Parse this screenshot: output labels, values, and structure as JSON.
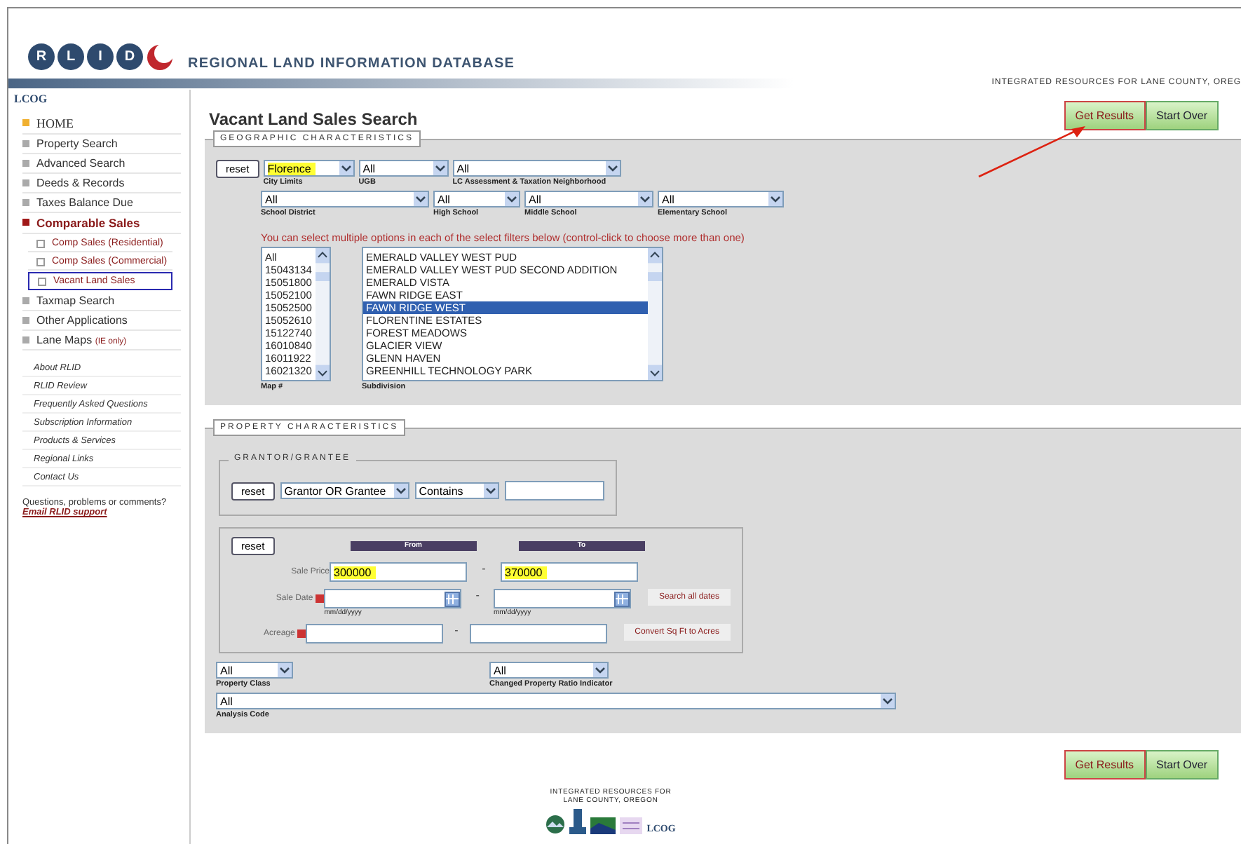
{
  "header": {
    "logo_letters": [
      "R",
      "L",
      "I",
      "D"
    ],
    "title": "REGIONAL LAND INFORMATION DATABASE",
    "tagline": "INTEGRATED RESOURCES FOR LANE COUNTY, OREG"
  },
  "sidebar": {
    "org": "LCOG",
    "items": [
      {
        "label": "HOME",
        "kind": "home",
        "selected": false
      },
      {
        "label": "Property Search",
        "kind": "main",
        "selected": false
      },
      {
        "label": "Advanced Search",
        "kind": "main",
        "selected": false
      },
      {
        "label": "Deeds & Records",
        "kind": "main",
        "selected": false
      },
      {
        "label": "Taxes Balance Due",
        "kind": "main",
        "selected": false
      },
      {
        "label": "Comparable Sales",
        "kind": "main",
        "selected": true
      },
      {
        "label": "Comp Sales (Residential)",
        "kind": "sub",
        "selected": false
      },
      {
        "label": "Comp Sales (Commercial)",
        "kind": "sub",
        "selected": false
      },
      {
        "label": "Vacant Land Sales",
        "kind": "sub",
        "selected": true
      },
      {
        "label": "Taxmap Search",
        "kind": "main",
        "selected": false
      },
      {
        "label": "Other Applications",
        "kind": "main",
        "selected": false
      },
      {
        "label": "Lane Maps",
        "note": "(IE only)",
        "kind": "main",
        "selected": false
      }
    ],
    "links": [
      "About RLID",
      "RLID Review",
      "Frequently Asked Questions",
      "Subscription Information",
      "Products & Services",
      "Regional Links",
      "Contact Us"
    ],
    "help_text": "Questions, problems or comments?",
    "help_link": "Email RLID support"
  },
  "page_title": "Vacant Land Sales Search",
  "top_buttons": [
    {
      "label": "Get Results",
      "kind": "primary"
    },
    {
      "label": "Start Over",
      "kind": "secondary"
    }
  ],
  "geographic": {
    "legend": "GEOGRAPHIC CHARACTERISTICS",
    "reset": "reset",
    "row_1": [
      {
        "value": "Florence",
        "label": "City Limits",
        "highlighted": true
      },
      {
        "value": "All",
        "label": "UGB",
        "highlighted": false
      },
      {
        "value": "All",
        "label": "LC Assessment & Taxation Neighborhood",
        "highlighted": false
      }
    ],
    "row_2": [
      {
        "value": "All",
        "label": "School District",
        "highlighted": false
      },
      {
        "value": "All",
        "label": "High School",
        "highlighted": false
      },
      {
        "value": "All",
        "label": "Middle School",
        "highlighted": false
      },
      {
        "value": "All",
        "label": "Elementary School",
        "highlighted": false
      }
    ],
    "instruction": "You can select multiple options in each of the select filters below (control-click to choose more than one)",
    "map_list": {
      "label": "Map #",
      "options": [
        {
          "text": "All",
          "selected": false
        },
        {
          "text": "15043134",
          "selected": false
        },
        {
          "text": "15051800",
          "selected": false
        },
        {
          "text": "15052100",
          "selected": false
        },
        {
          "text": "15052500",
          "selected": false
        },
        {
          "text": "15052610",
          "selected": false
        },
        {
          "text": "15122740",
          "selected": false
        },
        {
          "text": "16010840",
          "selected": false
        },
        {
          "text": "16011922",
          "selected": false
        },
        {
          "text": "16021320",
          "selected": false
        }
      ]
    },
    "subdivision_list": {
      "label": "Subdivision",
      "options": [
        {
          "text": "EMERALD VALLEY WEST PUD",
          "selected": false
        },
        {
          "text": "EMERALD VALLEY WEST PUD SECOND ADDITION",
          "selected": false
        },
        {
          "text": "EMERALD VISTA",
          "selected": false
        },
        {
          "text": "FAWN RIDGE EAST",
          "selected": false
        },
        {
          "text": "FAWN RIDGE WEST",
          "selected": true
        },
        {
          "text": "FLORENTINE ESTATES",
          "selected": false
        },
        {
          "text": "FOREST MEADOWS",
          "selected": false
        },
        {
          "text": "GLACIER VIEW",
          "selected": false
        },
        {
          "text": "GLENN HAVEN",
          "selected": false
        },
        {
          "text": "GREENHILL TECHNOLOGY PARK",
          "selected": false
        }
      ]
    }
  },
  "property": {
    "legend": "PROPERTY CHARACTERISTICS",
    "grantor": {
      "legend": "GRANTOR/GRANTEE",
      "reset": "reset",
      "party": "Grantor OR Grantee",
      "match": "Contains"
    },
    "range": {
      "reset": "reset",
      "from_heading": "From",
      "to_heading": "To",
      "separator": "-",
      "rows": [
        {
          "label": "Sale Price",
          "from": "300000",
          "to": "370000",
          "highlighted": true,
          "has_help": false,
          "has_calendar": false
        },
        {
          "label": "Sale Date",
          "from": "",
          "to": "",
          "from_hint": "mm/dd/yyyy",
          "to_hint": "mm/dd/yyyy",
          "highlighted": false,
          "has_help": true,
          "has_calendar": true,
          "action": "Search all dates"
        },
        {
          "label": "Acreage",
          "from": "",
          "to": "",
          "highlighted": false,
          "has_help": true,
          "has_calendar": false,
          "action": "Convert Sq Ft to Acres"
        }
      ]
    },
    "property_class": {
      "value": "All",
      "label": "Property Class"
    },
    "ratio_indicator": {
      "value": "All",
      "label": "Changed Property Ratio Indicator"
    },
    "analysis_code": {
      "value": "All",
      "label": "Analysis Code"
    }
  },
  "bottom_buttons": [
    {
      "label": "Get Results",
      "kind": "primary"
    },
    {
      "label": "Start Over",
      "kind": "secondary"
    }
  ],
  "footer": {
    "text": "INTEGRATED RESOURCES FOR",
    "text_2": "LANE COUNTY, OREGON",
    "logo_word": "LCOG"
  }
}
